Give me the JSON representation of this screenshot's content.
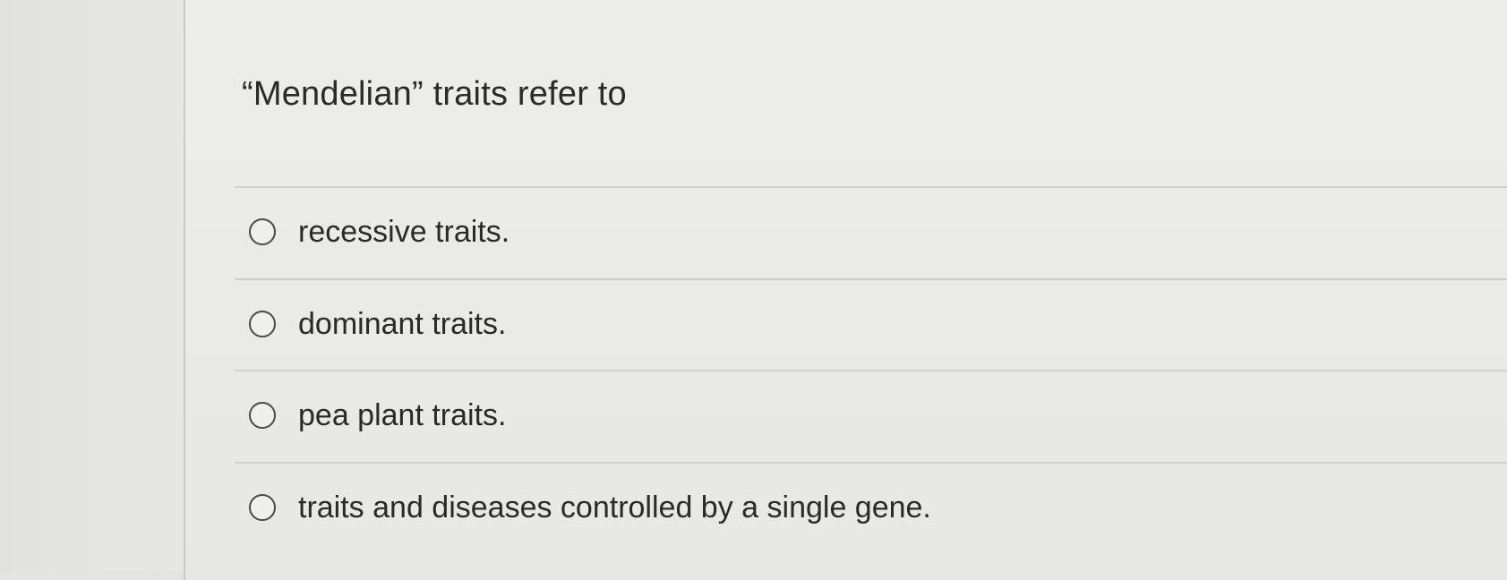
{
  "question": {
    "text": "“Mendelian” traits refer to"
  },
  "options": [
    {
      "label": "recessive traits.",
      "selected": false
    },
    {
      "label": "dominant traits.",
      "selected": false
    },
    {
      "label": "pea plant traits.",
      "selected": false
    },
    {
      "label": "traits and diseases controlled by a single gene.",
      "selected": false
    }
  ]
}
